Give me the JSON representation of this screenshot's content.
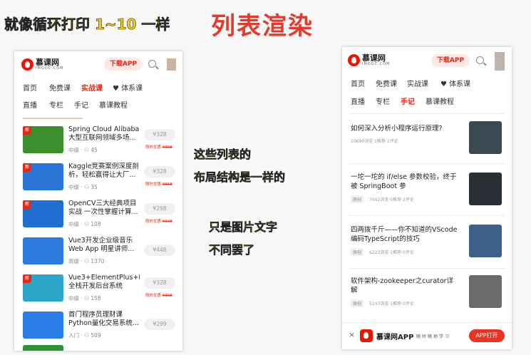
{
  "headline": {
    "small": "就像循环打印 1~10 一样",
    "big": "列表渲染"
  },
  "brand": {
    "name": "慕课网",
    "sub": "IMOOC.COM",
    "download_label": "下载APP",
    "accent": "#e02b1a"
  },
  "left": {
    "nav_row1": [
      "首页",
      "免费课",
      "实战课",
      "体系课"
    ],
    "nav_row2": [
      "直播",
      "专栏",
      "手记",
      "慕课教程"
    ],
    "active": "实战课",
    "new_badge": "新",
    "courses": [
      {
        "title": "Spring Cloud Alibaba 大型互联网领域多场...",
        "level": "中级",
        "students": "45",
        "price": "¥328",
        "promo": "限时优惠",
        "orig": "¥368",
        "thumb": "#3b8f2d",
        "is_new": true
      },
      {
        "title": "Kaggle竞赛案例深度剖析，轻松赢得让大厂...",
        "level": "中级",
        "students": "35",
        "price": "¥328",
        "promo": "限时优惠",
        "orig": "¥368",
        "thumb": "#2a75d6",
        "is_new": true
      },
      {
        "title": "OpenCV三大经典项目实战 一次性掌握计算...",
        "level": "中级",
        "students": "108",
        "price": "¥298",
        "promo": "限时优惠",
        "orig": "¥348",
        "thumb": "#1f6fd0",
        "is_new": true
      },
      {
        "title": "Vue3开发企业级音乐Web App 明星讲师...",
        "level": "高级",
        "students": "1370",
        "price": "¥448",
        "promo": "",
        "orig": "",
        "thumb": "#2b7be0",
        "is_new": false
      },
      {
        "title": "Vue3+ElementPlus+Koa2 全栈开发后台系统",
        "level": "中级",
        "students": "158",
        "price": "¥328",
        "promo": "限时优惠",
        "orig": "¥368",
        "thumb": "#2fa5c9",
        "is_new": true
      },
      {
        "title": "首门程序员理财课 Python量化交易系统...",
        "level": "入门",
        "students": "509",
        "price": "¥299",
        "promo": "",
        "orig": "",
        "thumb": "#2a7ee6",
        "is_new": false
      }
    ]
  },
  "right": {
    "nav_row1": [
      "首页",
      "免费课",
      "实战课",
      "体系课"
    ],
    "nav_row2": [
      "直播",
      "专栏",
      "手记",
      "慕课教程"
    ],
    "active": "手记",
    "articles": [
      {
        "title": "如何深入分析小程序运行原理?",
        "tag": "",
        "meta": "10690浏览·1推荐·1评论",
        "img": "#3a4a52"
      },
      {
        "title": "一坨一坨的 if/else 参数校验，终于被 SpringBoot 参",
        "tag": "原创",
        "meta": "7042浏览·0推荐·2评论",
        "img": "#2a2f36"
      },
      {
        "title": "四两拨千斤——你不知道的VScode编码TypeScript的技巧",
        "tag": "原创",
        "meta": "6223浏览·1推荐·0评论",
        "img": "#3d5f8a"
      },
      {
        "title": "软件架构-zookeeper之curator详解",
        "tag": "原创",
        "meta": "5243浏览·1推荐·0评论",
        "img": "#6b6b6b"
      }
    ],
    "footer": {
      "close": "×",
      "app_name": "慕课网APP",
      "slogan": "随时随地学习",
      "open_label": "APP打开"
    }
  },
  "annotations": {
    "line1": "这些列表的",
    "line2": "布局结构是一样的",
    "line3": "只是图片文字",
    "line4": "不同罢了"
  }
}
